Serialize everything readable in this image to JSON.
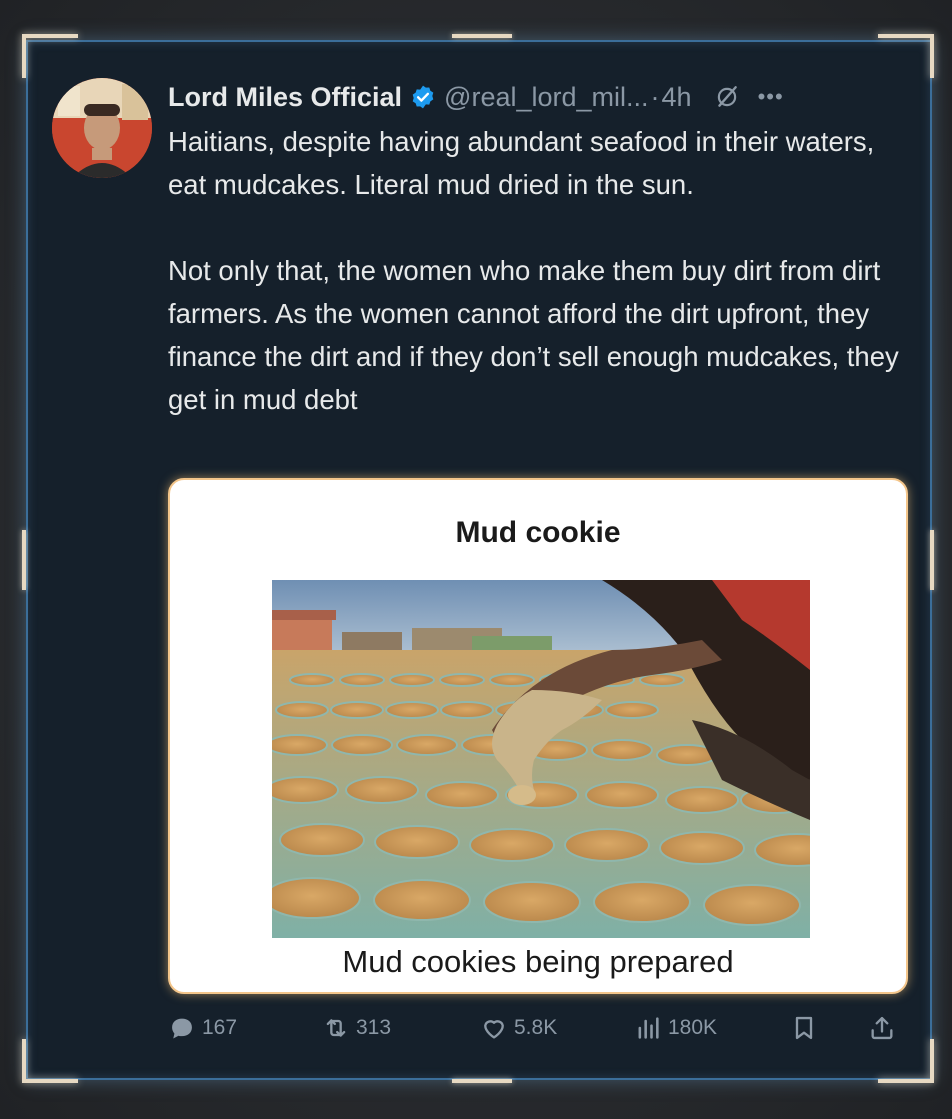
{
  "tweet": {
    "display_name": "Lord Miles Official",
    "handle": "@real_lord_mil...",
    "separator": "·",
    "time": "4h",
    "text_paragraph_1": "Haitians, despite having abundant seafood in their waters,  eat mudcakes. Literal mud dried in the sun.",
    "text_paragraph_2": "Not only that, the women who make them buy dirt from dirt farmers. As the women cannot afford the dirt upfront, they finance the dirt and if they don’t sell enough mudcakes, they get in mud debt"
  },
  "card": {
    "title": "Mud cookie",
    "caption": "Mud cookies being prepared"
  },
  "actions": {
    "replies": "167",
    "retweets": "313",
    "likes": "5.8K",
    "views": "180K"
  },
  "icons": {
    "verified": "verified-badge-icon",
    "grok": "grok-icon",
    "more": "more-icon",
    "reply": "reply-icon",
    "retweet": "retweet-icon",
    "like": "heart-icon",
    "views": "bar-chart-icon",
    "bookmark": "bookmark-icon",
    "share": "share-icon"
  },
  "colors": {
    "background": "#15202b",
    "text": "#e7e9ea",
    "muted": "#8b98a5",
    "verified": "#1d9bf0"
  }
}
